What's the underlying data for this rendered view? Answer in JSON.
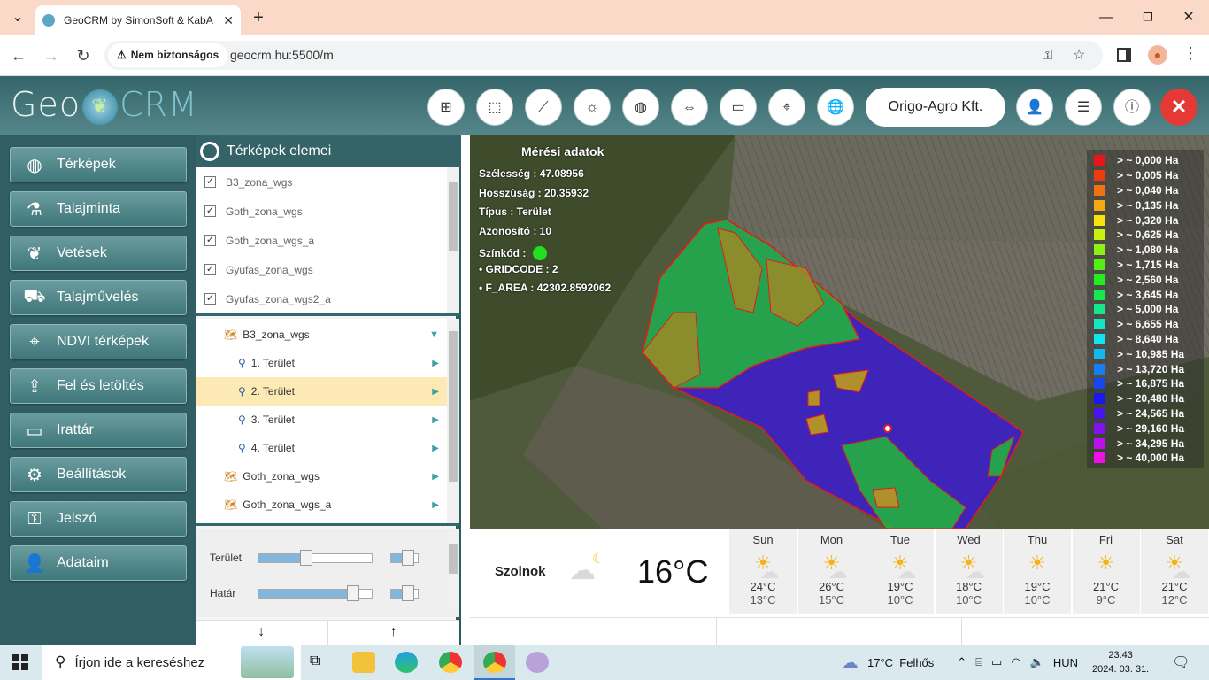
{
  "browser": {
    "tab_title": "GeoCRM by SimonSoft & KabA",
    "security_label": "Nem biztonságos",
    "url": "geocrm.hu:5500/m"
  },
  "header": {
    "logo_left": "Geo",
    "logo_right": "CRM",
    "company": "Origo-Agro Kft."
  },
  "sidebar": {
    "items": [
      {
        "label": "Térképek",
        "icon": "globe-icon"
      },
      {
        "label": "Talajminta",
        "icon": "flask-icon"
      },
      {
        "label": "Vetések",
        "icon": "seedling-icon"
      },
      {
        "label": "Talajművelés",
        "icon": "tractor-icon"
      },
      {
        "label": "NDVI térképek",
        "icon": "crosshair-icon"
      },
      {
        "label": "Fel és letöltés",
        "icon": "upload-icon"
      },
      {
        "label": "Irattár",
        "icon": "folder-icon"
      },
      {
        "label": "Beállítások",
        "icon": "gear-icon"
      },
      {
        "label": "Jelszó",
        "icon": "key-icon"
      },
      {
        "label": "Adataim",
        "icon": "user-icon"
      }
    ]
  },
  "layers_panel": {
    "title": "Térképek elemei",
    "checked_layers": [
      "B3_zona_wgs",
      "Goth_zona_wgs",
      "Goth_zona_wgs_a",
      "Gyufas_zona_wgs",
      "Gyufas_zona_wgs2_a"
    ],
    "tree": [
      {
        "label": "B3_zona_wgs",
        "level": 0,
        "expanded": true
      },
      {
        "label": "1. Terület",
        "level": 1
      },
      {
        "label": "2. Terület",
        "level": 1,
        "selected": true
      },
      {
        "label": "3. Terület",
        "level": 1
      },
      {
        "label": "4. Terület",
        "level": 1
      },
      {
        "label": "Goth_zona_wgs",
        "level": 0
      },
      {
        "label": "Goth_zona_wgs_a",
        "level": 0
      }
    ],
    "sliders": [
      {
        "label": "Terület",
        "value": 0.42
      },
      {
        "label": "Határ",
        "value": 0.88
      }
    ]
  },
  "map": {
    "info_title": "Mérési adatok",
    "info_lines": [
      "Szélesség : 47.08956",
      "Hosszúság : 20.35932",
      "Típus : Terület",
      "Azonosító : 10",
      "Színkód :",
      "• GRIDCODE : 2",
      "• F_AREA : 42302.8592062"
    ],
    "colorcode": "#22dd22",
    "legend": [
      {
        "label": "> ~ 0,000 Ha",
        "color": "#e8161b"
      },
      {
        "label": "> ~ 0,005 Ha",
        "color": "#f03a10"
      },
      {
        "label": "> ~ 0,040 Ha",
        "color": "#f27110"
      },
      {
        "label": "> ~ 0,135 Ha",
        "color": "#f5a910"
      },
      {
        "label": "> ~ 0,320 Ha",
        "color": "#f7e40e"
      },
      {
        "label": "> ~ 0,625 Ha",
        "color": "#c9f010"
      },
      {
        "label": "> ~ 1,080 Ha",
        "color": "#8ef014"
      },
      {
        "label": "> ~ 1,715 Ha",
        "color": "#55ef18"
      },
      {
        "label": "> ~ 2,560 Ha",
        "color": "#22ec22"
      },
      {
        "label": "> ~ 3,645 Ha",
        "color": "#18e850"
      },
      {
        "label": "> ~ 5,000 Ha",
        "color": "#14e88a"
      },
      {
        "label": "> ~ 6,655 Ha",
        "color": "#12e7c2"
      },
      {
        "label": "> ~ 8,640 Ha",
        "color": "#10e6f0"
      },
      {
        "label": "> ~ 10,985 Ha",
        "color": "#12b8f0"
      },
      {
        "label": "> ~ 13,720 Ha",
        "color": "#1480f0"
      },
      {
        "label": "> ~ 16,875 Ha",
        "color": "#1646f0"
      },
      {
        "label": "> ~ 20,480 Ha",
        "color": "#1a18ee"
      },
      {
        "label": "> ~ 24,565 Ha",
        "color": "#4a14ee"
      },
      {
        "label": "> ~ 29,160 Ha",
        "color": "#8212ee"
      },
      {
        "label": "> ~ 34,295 Ha",
        "color": "#bb10ee"
      },
      {
        "label": "> ~ 40,000 Ha",
        "color": "#ee10e6"
      }
    ]
  },
  "weather": {
    "city": "Szolnok",
    "current_temp": "16°C",
    "days": [
      {
        "day": "Sun",
        "hi": "24°C",
        "lo": "13°C",
        "icon": "partly-cloudy-icon"
      },
      {
        "day": "Mon",
        "hi": "26°C",
        "lo": "15°C",
        "icon": "partly-cloudy-icon"
      },
      {
        "day": "Tue",
        "hi": "19°C",
        "lo": "10°C",
        "icon": "partly-cloudy-icon"
      },
      {
        "day": "Wed",
        "hi": "18°C",
        "lo": "10°C",
        "icon": "partly-cloudy-icon"
      },
      {
        "day": "Thu",
        "hi": "19°C",
        "lo": "10°C",
        "icon": "sun-icon"
      },
      {
        "day": "Fri",
        "hi": "21°C",
        "lo": "9°C",
        "icon": "sun-icon"
      },
      {
        "day": "Sat",
        "hi": "21°C",
        "lo": "12°C",
        "icon": "partly-cloudy-icon"
      }
    ]
  },
  "taskbar": {
    "search_placeholder": "Írjon ide a kereséshez",
    "weather": "17°C  Felhős",
    "lang": "HUN",
    "time": "23:43",
    "date": "2024. 03. 31."
  }
}
